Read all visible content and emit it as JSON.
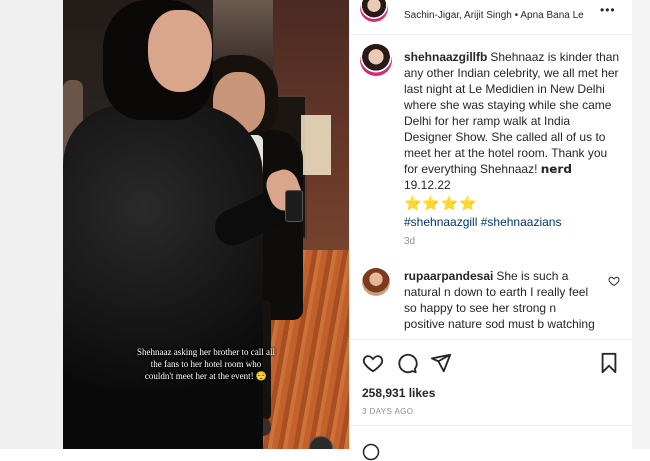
{
  "header": {
    "audio": "Sachin-Jigar, Arijit Singh • Apna Bana Le",
    "more_label": "•••"
  },
  "media": {
    "caption_lines": [
      "Shehnaaz asking her brother to call all",
      "the fans to her hotel room who",
      "couldn't meet her at the event! 😌"
    ]
  },
  "post_caption": {
    "username": "shehnaazgillfb",
    "text": "Shehnaaz is kinder than any other Indian celebrity, we all met her last night at Le Medidien in New Delhi where she was staying while she came Delhi for her ramp walk at India Designer Show. She called all of us to meet her at the hotel room. Thank you for everything Shehnaaz! 𝗻𝗲𝗿𝗱 19.12.22",
    "stars": "⭐⭐⭐⭐",
    "hashtags": "#shehnaazgill #shehnaazians",
    "time": "3d"
  },
  "comment": {
    "username": "rupaarpandesai",
    "text": "She is such a natural n down to earth I really feel so happy to see her strong n positive nature sod must b watching"
  },
  "stats": {
    "likes": "258,931 likes",
    "posted": "3 DAYS AGO"
  }
}
